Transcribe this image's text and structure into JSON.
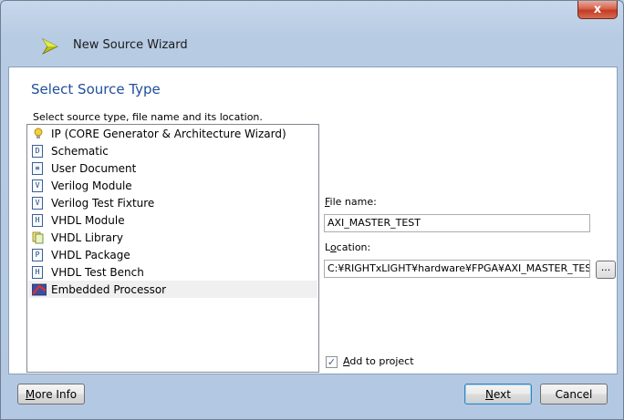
{
  "window": {
    "title": "New Source Wizard",
    "close_glyph": "x"
  },
  "page": {
    "section_title": "Select Source Type",
    "instruction": "Select source type, file name and its location."
  },
  "source_types": [
    {
      "label": "IP (CORE Generator & Architecture Wizard)",
      "icon": "ip-core-icon",
      "glyph": ""
    },
    {
      "label": "Schematic",
      "icon": "schematic-icon",
      "glyph": "D"
    },
    {
      "label": "User Document",
      "icon": "user-document-icon",
      "glyph": "≡"
    },
    {
      "label": "Verilog Module",
      "icon": "verilog-module-icon",
      "glyph": "V"
    },
    {
      "label": "Verilog Test Fixture",
      "icon": "verilog-test-fixture-icon",
      "glyph": "V"
    },
    {
      "label": "VHDL Module",
      "icon": "vhdl-module-icon",
      "glyph": "H"
    },
    {
      "label": "VHDL Library",
      "icon": "vhdl-library-icon",
      "glyph": ""
    },
    {
      "label": "VHDL Package",
      "icon": "vhdl-package-icon",
      "glyph": "P"
    },
    {
      "label": "VHDL Test Bench",
      "icon": "vhdl-test-bench-icon",
      "glyph": "H"
    },
    {
      "label": "Embedded Processor",
      "icon": "embedded-processor-icon",
      "glyph": "",
      "selected": true
    }
  ],
  "file_name": {
    "label_accel": "F",
    "label_rest": "ile name:",
    "value": "AXI_MASTER_TEST"
  },
  "location": {
    "label_prefix": "L",
    "label_accel": "o",
    "label_rest": "cation:",
    "value": "C:¥RIGHTxLIGHT¥hardware¥FPGA¥AXI_MASTER_TEST",
    "browse_label": "..."
  },
  "add_to_project": {
    "label_accel": "A",
    "label_rest": "dd to project",
    "checked": true,
    "check_glyph": "✓"
  },
  "buttons": {
    "more_info_accel": "M",
    "more_info_rest": "ore Info",
    "next_accel": "N",
    "next_rest": "ext",
    "cancel": "Cancel"
  }
}
